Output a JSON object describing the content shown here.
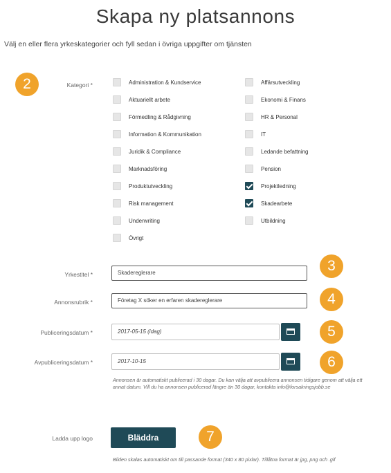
{
  "header": {
    "title": "Skapa ny platsannons",
    "subtitle": "Välj en eller flera yrkeskategorier och fyll sedan i övriga uppgifter om tjänsten"
  },
  "badges": [
    "2",
    "3",
    "4",
    "5",
    "6",
    "7"
  ],
  "category": {
    "label": "Kategori *",
    "left": [
      {
        "label": "Administration & Kundservice",
        "checked": false
      },
      {
        "label": "Aktuariellt arbete",
        "checked": false
      },
      {
        "label": "Förmedling & Rådgivning",
        "checked": false
      },
      {
        "label": "Information & Kommunikation",
        "checked": false
      },
      {
        "label": "Juridik & Compliance",
        "checked": false
      },
      {
        "label": "Marknadsföring",
        "checked": false
      },
      {
        "label": "Produktutveckling",
        "checked": false
      },
      {
        "label": "Risk management",
        "checked": false
      },
      {
        "label": "Underwriting",
        "checked": false
      },
      {
        "label": "Övrigt",
        "checked": false
      }
    ],
    "right": [
      {
        "label": "Affärsutveckling",
        "checked": false
      },
      {
        "label": "Ekonomi & Finans",
        "checked": false
      },
      {
        "label": "HR & Personal",
        "checked": false
      },
      {
        "label": "IT",
        "checked": false
      },
      {
        "label": "Ledande befattning",
        "checked": false
      },
      {
        "label": "Pension",
        "checked": false
      },
      {
        "label": "Projektledning",
        "checked": true
      },
      {
        "label": "Skadearbete",
        "checked": true
      },
      {
        "label": "Utbildning",
        "checked": false
      }
    ]
  },
  "fields": {
    "title": {
      "label": "Yrkestitel *",
      "value": "Skadereglerare"
    },
    "headline": {
      "label": "Annonsrubrik *",
      "value": "Företag X söker en erfaren skadereglerare"
    },
    "publish": {
      "label": "Publiceringsdatum *",
      "value": "2017-05-15 (idag)"
    },
    "unpublish": {
      "label": "Avpubliceringsdatum *",
      "value": "2017-10-15"
    }
  },
  "notes": {
    "publish_note": "Annonsen är automatiskt publicerad i 30 dagar. Du kan välja att avpublicera annonsen tidigare genom att välja ett annat datum. Vill du ha annonsen publicerad längre än 30 dagar, kontakta info@forsakringsjobb.se",
    "logo_note": "Bilden skalas automatiskt om till passande format (340 x 80 pixlar). Tillåtna format är jpg, png och .gif"
  },
  "logo": {
    "label": "Ladda upp logo",
    "button": "Bläddra"
  },
  "colors": {
    "accent": "#f0a32b",
    "primary": "#1f4a57"
  },
  "icons": {
    "calendar": "calendar-icon",
    "checkmark": "checkmark-icon"
  }
}
